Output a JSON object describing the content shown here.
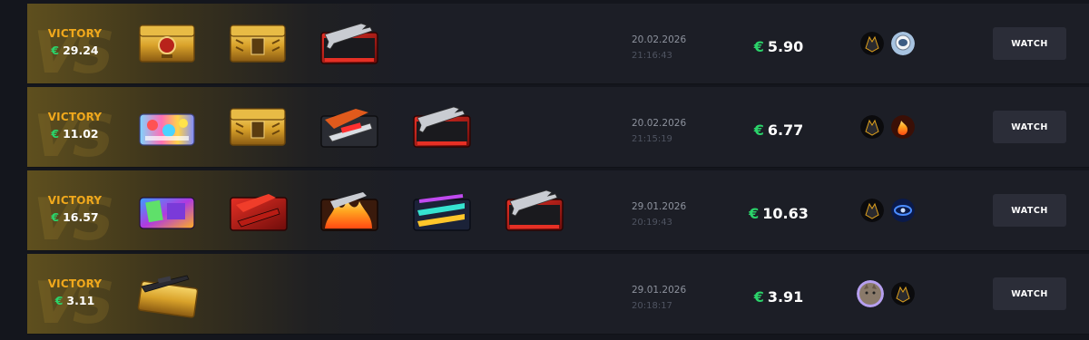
{
  "currency_symbol": "€",
  "colors": {
    "victory": "#f0a81c",
    "currency": "#2bd46a",
    "background": "#14161d",
    "row": "#1c1e26",
    "button": "#2b2d38"
  },
  "rows": [
    {
      "result": "VICTORY",
      "winnings": "29.24",
      "cases": [
        "gold-case-red-emblem-icon",
        "gold-case-icon",
        "red-rifle-case-icon"
      ],
      "date": "20.02.2026",
      "time": "21:16:43",
      "price": "5.90",
      "players": [
        "dark-wolf-avatar",
        "astronaut-avatar"
      ],
      "watch_label": "WATCH"
    },
    {
      "result": "VICTORY",
      "winnings": "11.02",
      "cases": [
        "colorful-sticker-case-icon",
        "gold-case-icon",
        "graffiti-weapon-case-icon",
        "red-rifle-case-icon"
      ],
      "date": "20.02.2026",
      "time": "21:15:19",
      "price": "6.77",
      "players": [
        "dark-wolf-avatar",
        "fire-avatar"
      ],
      "watch_label": "WATCH"
    },
    {
      "result": "VICTORY",
      "winnings": "16.57",
      "cases": [
        "neon-mixed-case-icon",
        "red-weapons-case-icon",
        "fire-case-icon",
        "neon-weapons-case-icon",
        "red-rifle-case-icon"
      ],
      "date": "29.01.2026",
      "time": "20:19:43",
      "price": "10.63",
      "players": [
        "dark-wolf-avatar",
        "blue-logo-avatar"
      ],
      "watch_label": "WATCH"
    },
    {
      "result": "VICTORY",
      "winnings": "3.11",
      "cases": [
        "gold-sniper-case-icon"
      ],
      "date": "29.01.2026",
      "time": "20:18:17",
      "price": "3.91",
      "players": [
        "cat-avatar",
        "dark-wolf-avatar"
      ],
      "watch_label": "WATCH"
    }
  ]
}
